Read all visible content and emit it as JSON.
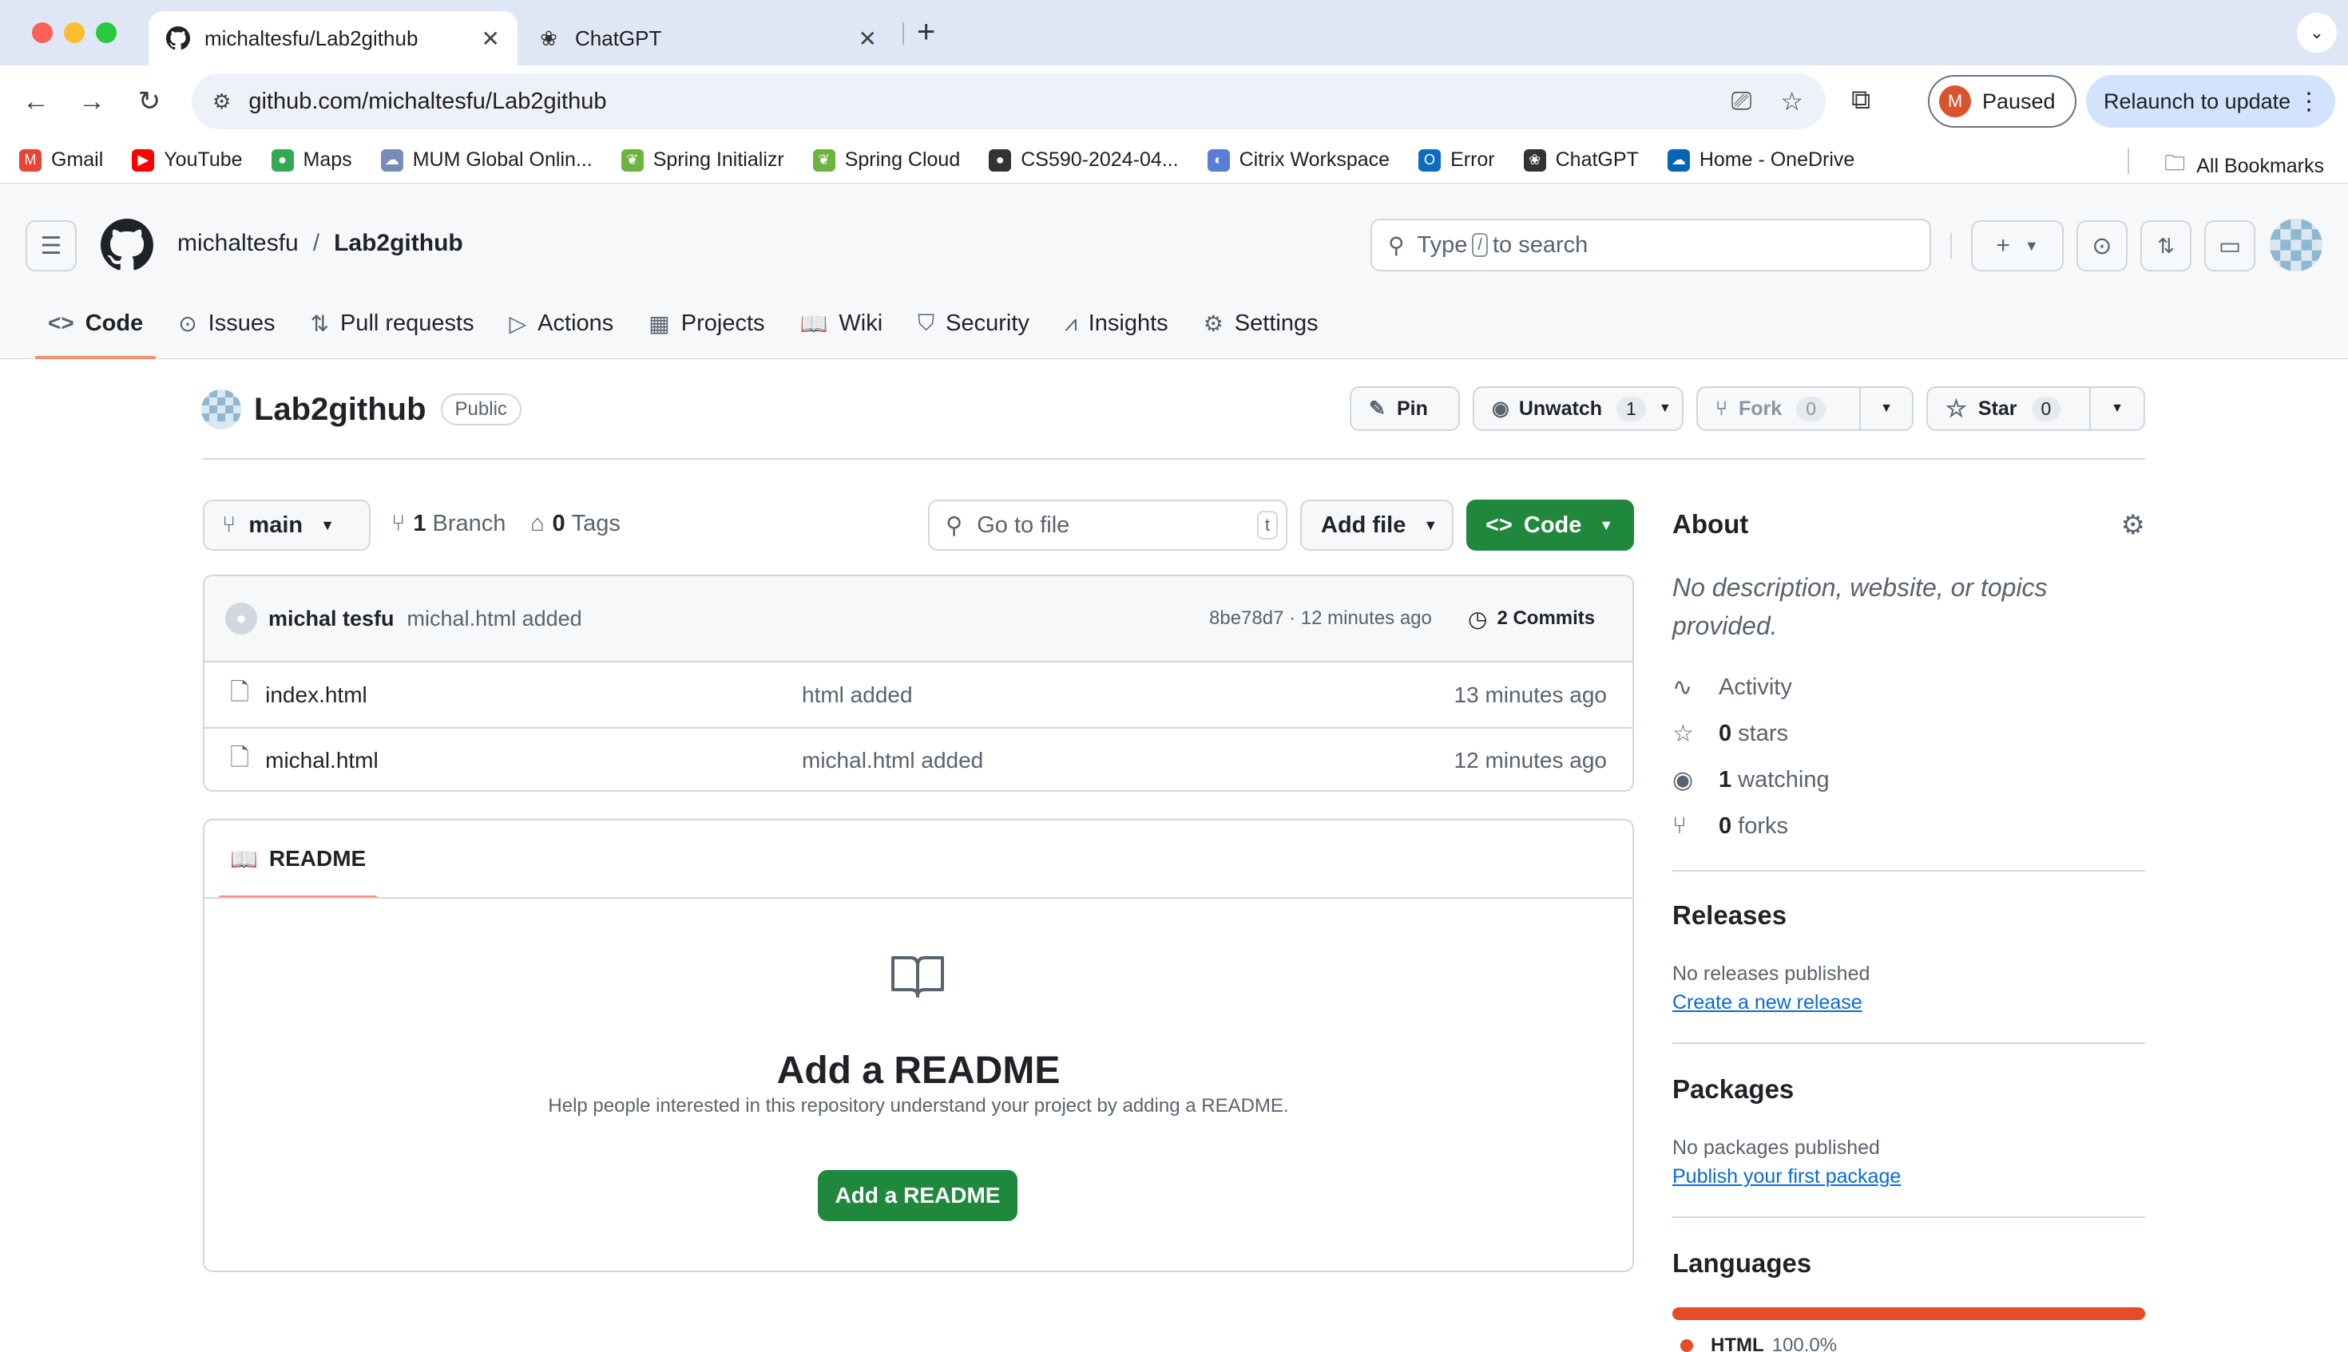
{
  "browser": {
    "tabs": [
      {
        "title": "michaltesfu/Lab2github",
        "active": true
      },
      {
        "title": "ChatGPT",
        "active": false
      }
    ],
    "url": "github.com/michaltesfu/Lab2github",
    "profile_initial": "M",
    "profile_status": "Paused",
    "relaunch_label": "Relaunch to update",
    "bookmarks": [
      {
        "label": "Gmail",
        "icon": "gmail-icon",
        "color": "#ea4335"
      },
      {
        "label": "YouTube",
        "icon": "youtube-icon",
        "color": "#ff0000"
      },
      {
        "label": "Maps",
        "icon": "maps-icon",
        "color": "#34a853"
      },
      {
        "label": "MUM Global Onlin...",
        "icon": "mum-icon",
        "color": "#7b8bb8"
      },
      {
        "label": "Spring Initializr",
        "icon": "spring-icon",
        "color": "#6db33f"
      },
      {
        "label": "Spring Cloud",
        "icon": "spring-icon",
        "color": "#6db33f"
      },
      {
        "label": "CS590-2024-04...",
        "icon": "github-icon",
        "color": "#333333"
      },
      {
        "label": "Citrix Workspace",
        "icon": "citrix-icon",
        "color": "#5b7dd8"
      },
      {
        "label": "Error",
        "icon": "outlook-icon",
        "color": "#0f6cbd"
      },
      {
        "label": "ChatGPT",
        "icon": "chatgpt-icon",
        "color": "#333333"
      },
      {
        "label": "Home - OneDrive",
        "icon": "onedrive-icon",
        "color": "#0364b8"
      }
    ],
    "all_bookmarks_label": "All Bookmarks"
  },
  "github": {
    "owner": "michaltesfu",
    "separator": "/",
    "repo": "Lab2github",
    "search": {
      "prefix": "Type",
      "key": "/",
      "suffix": "to search"
    },
    "nav": [
      {
        "label": "Code",
        "icon": "code-icon",
        "active": true
      },
      {
        "label": "Issues",
        "icon": "issue-icon"
      },
      {
        "label": "Pull requests",
        "icon": "pull-request-icon"
      },
      {
        "label": "Actions",
        "icon": "play-icon"
      },
      {
        "label": "Projects",
        "icon": "table-icon"
      },
      {
        "label": "Wiki",
        "icon": "book-icon"
      },
      {
        "label": "Security",
        "icon": "shield-icon"
      },
      {
        "label": "Insights",
        "icon": "graph-icon"
      },
      {
        "label": "Settings",
        "icon": "gear-icon"
      }
    ]
  },
  "repo": {
    "name": "Lab2github",
    "visibility": "Public",
    "pin_label": "Pin",
    "unwatch_label": "Unwatch",
    "watch_count": "1",
    "fork_label": "Fork",
    "fork_count": "0",
    "star_label": "Star",
    "star_count": "0"
  },
  "toolbar": {
    "branch": "main",
    "branch_count": "1",
    "branch_label": "Branch",
    "tag_count": "0",
    "tag_label": "Tags",
    "goto_placeholder": "Go to file",
    "goto_key": "t",
    "add_file_label": "Add file",
    "code_label": "Code"
  },
  "latest_commit": {
    "author": "michal tesfu",
    "message": "michal.html added",
    "sha_time": "8be78d7 · 12 minutes ago",
    "commits_label": "2 Commits"
  },
  "files": [
    {
      "name": "index.html",
      "message": "html added",
      "age": "13 minutes ago"
    },
    {
      "name": "michal.html",
      "message": "michal.html added",
      "age": "12 minutes ago"
    }
  ],
  "readme": {
    "tab_label": "README",
    "heading": "Add a README",
    "subtitle": "Help people interested in this repository understand your project by adding a README.",
    "button_label": "Add a README"
  },
  "sidebar": {
    "about_title": "About",
    "about_desc": "No description, website, or topics provided.",
    "stats": [
      {
        "icon": "pulse-icon",
        "bold": "",
        "label": "Activity"
      },
      {
        "icon": "star-icon",
        "bold": "0",
        "label": "stars"
      },
      {
        "icon": "eye-icon",
        "bold": "1",
        "label": "watching"
      },
      {
        "icon": "fork-icon",
        "bold": "0",
        "label": "forks"
      }
    ],
    "releases_title": "Releases",
    "releases_text": "No releases published",
    "releases_link": "Create a new release",
    "packages_title": "Packages",
    "packages_text": "No packages published",
    "packages_link": "Publish your first package",
    "languages_title": "Languages",
    "languages": [
      {
        "name": "HTML",
        "percent": "100.0%",
        "value": 100.0,
        "color": "#e34c26"
      }
    ]
  }
}
